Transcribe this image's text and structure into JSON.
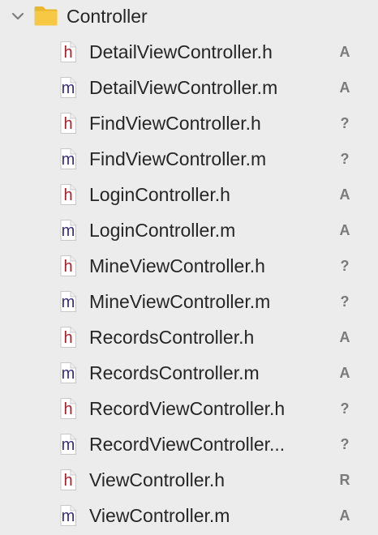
{
  "group": {
    "label": "Controller",
    "expanded": true,
    "disclosure_icon": "chevron-down-icon",
    "folder_icon": "folder-icon",
    "folder_color": "#f7c843"
  },
  "files": [
    {
      "type": "h",
      "name": "DetailViewController.h",
      "status": "A"
    },
    {
      "type": "m",
      "name": "DetailViewController.m",
      "status": "A"
    },
    {
      "type": "h",
      "name": "FindViewController.h",
      "status": "?"
    },
    {
      "type": "m",
      "name": "FindViewController.m",
      "status": "?"
    },
    {
      "type": "h",
      "name": "LoginController.h",
      "status": "A"
    },
    {
      "type": "m",
      "name": "LoginController.m",
      "status": "A"
    },
    {
      "type": "h",
      "name": "MineViewController.h",
      "status": "?"
    },
    {
      "type": "m",
      "name": "MineViewController.m",
      "status": "?"
    },
    {
      "type": "h",
      "name": "RecordsController.h",
      "status": "A"
    },
    {
      "type": "m",
      "name": "RecordsController.m",
      "status": "A"
    },
    {
      "type": "h",
      "name": "RecordViewController.h",
      "status": "?"
    },
    {
      "type": "m",
      "name": "RecordViewController...",
      "status": "?"
    },
    {
      "type": "h",
      "name": "ViewController.h",
      "status": "R"
    },
    {
      "type": "m",
      "name": "ViewController.m",
      "status": "A"
    }
  ],
  "colors": {
    "header_file": "#a5202a",
    "implementation_file": "#3c2f7a",
    "status_text": "#7a7a7a",
    "background": "#ececec"
  }
}
